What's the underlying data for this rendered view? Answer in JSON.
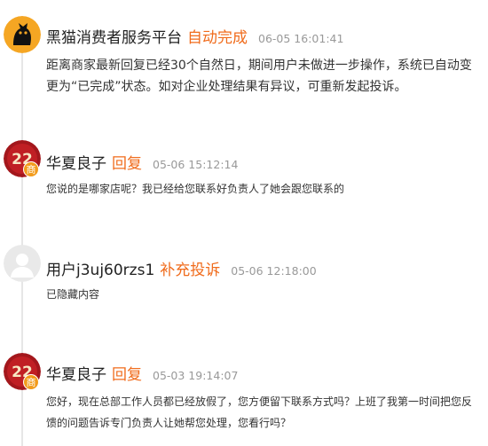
{
  "entries": [
    {
      "name": "黑猫消费者服务平台",
      "action": "自动完成",
      "time": "06-05 16:01:41",
      "text": "距离商家最新回复已经30个自然日，期间用户未做进一步操作，系统已自动变更为“已完成”状态。如对企业处理结果有异议，可重新发起投诉。"
    },
    {
      "name": "华夏良子",
      "action": "回复",
      "time": "05-06 15:12:14",
      "badge": "商",
      "text": "您说的是哪家店呢？我已经给您联系好负责人了她会跟您联系的"
    },
    {
      "name": "用户j3uj60rzs1",
      "action": "补充投诉",
      "time": "05-06 12:18:00",
      "text": "已隐藏内容"
    },
    {
      "name": "华夏良子",
      "action": "回复",
      "time": "05-03 19:14:07",
      "badge": "商",
      "text": "您好，现在总部工作人员都已经放假了，您方便留下联系方式吗？上班了我第一时间把您反馈的问题告诉专门负责人让她帮您处理，您看行吗？"
    }
  ],
  "colors": {
    "accent": "#f06b1b",
    "badge": "#f29b1b",
    "line": "#e6e6e6"
  },
  "icons": [
    "black-cat-logo-icon",
    "huaxia-liangzi-logo-icon",
    "default-user-avatar-icon"
  ]
}
